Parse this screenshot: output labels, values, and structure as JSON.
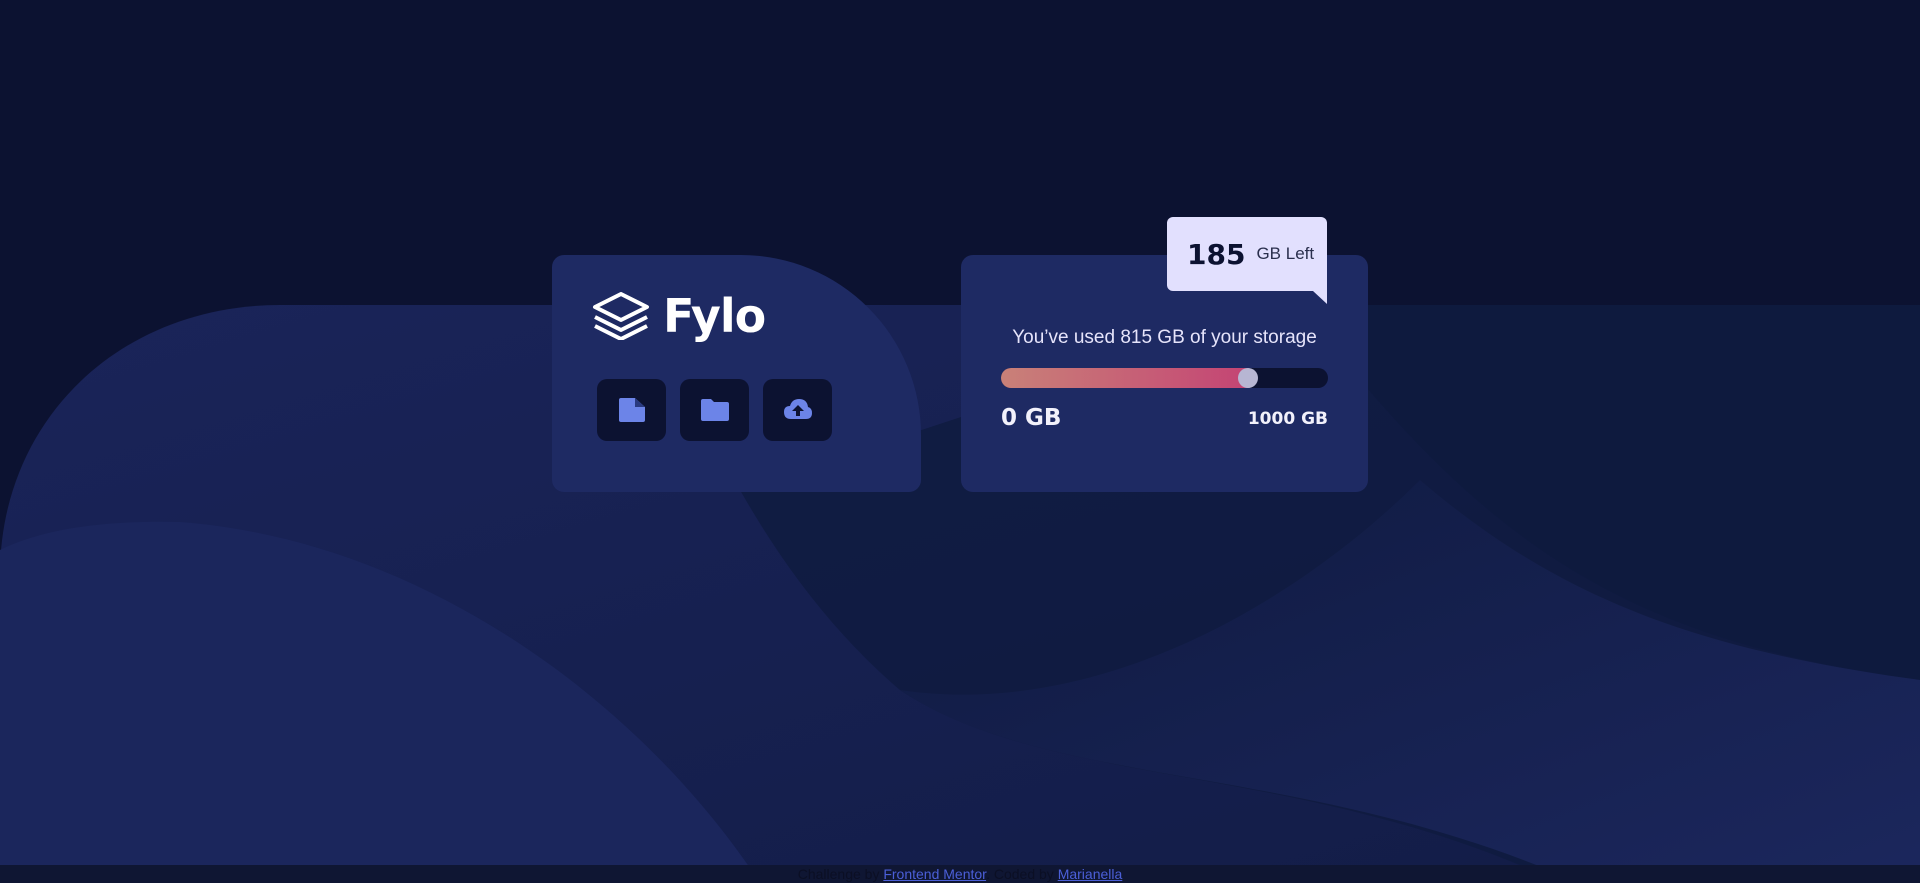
{
  "brand": {
    "name": "Fylo",
    "logo_icon": "layers-logo-icon"
  },
  "actions": [
    {
      "icon": "document-icon"
    },
    {
      "icon": "folder-icon"
    },
    {
      "icon": "upload-icon"
    }
  ],
  "usage": {
    "text": "You’ve used 815 GB of your storage",
    "used_gb": 815,
    "total_gb": 1000,
    "fraction_used": 0.815,
    "min_label": "0 GB",
    "max_label": "1000 GB"
  },
  "tooltip": {
    "value": "185",
    "unit": "GB Left"
  },
  "footer": {
    "prefix": "Challenge by",
    "challenge_link": "Frontend Mentor",
    "middle": ". Coded by",
    "author_link": "Marianella"
  },
  "colors": {
    "background": "#0c1231",
    "card": "#1e2a63",
    "tooltip": "#e2e0fe",
    "bar_gradient_start": "#c98178",
    "bar_gradient_end": "#c44274",
    "icon": "#6c84e8"
  }
}
